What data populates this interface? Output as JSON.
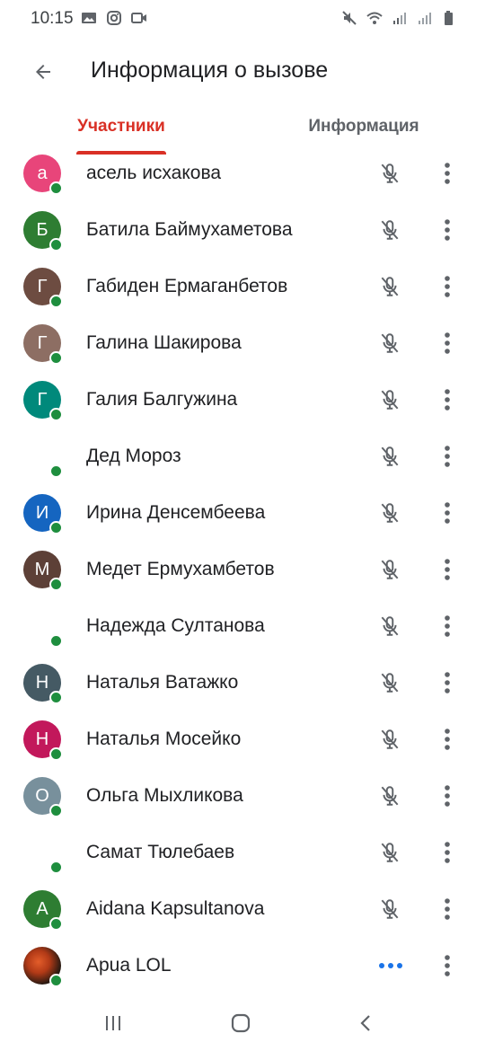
{
  "status_bar": {
    "time": "10:15",
    "left_icons": [
      "image-icon",
      "instagram-icon",
      "video-icon"
    ],
    "right_icons": [
      "mute-icon",
      "wifi-icon",
      "signal-icon",
      "signal-icon",
      "battery-icon"
    ]
  },
  "header": {
    "title": "Информация о вызове"
  },
  "tabs": [
    {
      "label": "Участники",
      "active": true
    },
    {
      "label": "Информация",
      "active": false
    }
  ],
  "colors": {
    "accent": "#d93025",
    "presence": "#1e8e3e",
    "speaking": "#1a73e8"
  },
  "participants": [
    {
      "name": "асель исхакова",
      "initial": "а",
      "avatar_color": "#e8457a",
      "status": "muted"
    },
    {
      "name": "Батила Баймухаметова",
      "initial": "Б",
      "avatar_color": "#2e7d32",
      "status": "muted"
    },
    {
      "name": "Габиден Ермаганбетов",
      "initial": "Г",
      "avatar_color": "#6d4c41",
      "status": "muted"
    },
    {
      "name": "Галина Шакирова",
      "initial": "Г",
      "avatar_color": "#8d6e63",
      "status": "muted"
    },
    {
      "name": "Галия Балгужина",
      "initial": "Г",
      "avatar_color": "#00897b",
      "status": "muted"
    },
    {
      "name": "Дед Мороз",
      "initial": "",
      "avatar_color": "",
      "status": "muted"
    },
    {
      "name": "Ирина Денсембеева",
      "initial": "И",
      "avatar_color": "#1565c0",
      "status": "muted"
    },
    {
      "name": "Медет Ермухамбетов",
      "initial": "М",
      "avatar_color": "#5d4037",
      "status": "muted"
    },
    {
      "name": "Надежда Султанова",
      "initial": "",
      "avatar_color": "",
      "status": "muted"
    },
    {
      "name": "Наталья Ватажко",
      "initial": "Н",
      "avatar_color": "#455a64",
      "status": "muted"
    },
    {
      "name": "Наталья Мосейко",
      "initial": "Н",
      "avatar_color": "#c2185b",
      "status": "muted"
    },
    {
      "name": "Ольга Мыхликова",
      "initial": "О",
      "avatar_color": "#78909c",
      "status": "muted"
    },
    {
      "name": "Самат Тюлебаев",
      "initial": "",
      "avatar_color": "",
      "status": "muted"
    },
    {
      "name": "Aidana Kapsultanova",
      "initial": "A",
      "avatar_color": "#2e7d32",
      "status": "muted"
    },
    {
      "name": "Apua LOL",
      "initial": "",
      "avatar_color": "#3a2418",
      "status": "speaking",
      "photo": true
    }
  ],
  "nav": [
    "recent-apps-icon",
    "home-icon",
    "back-icon"
  ]
}
